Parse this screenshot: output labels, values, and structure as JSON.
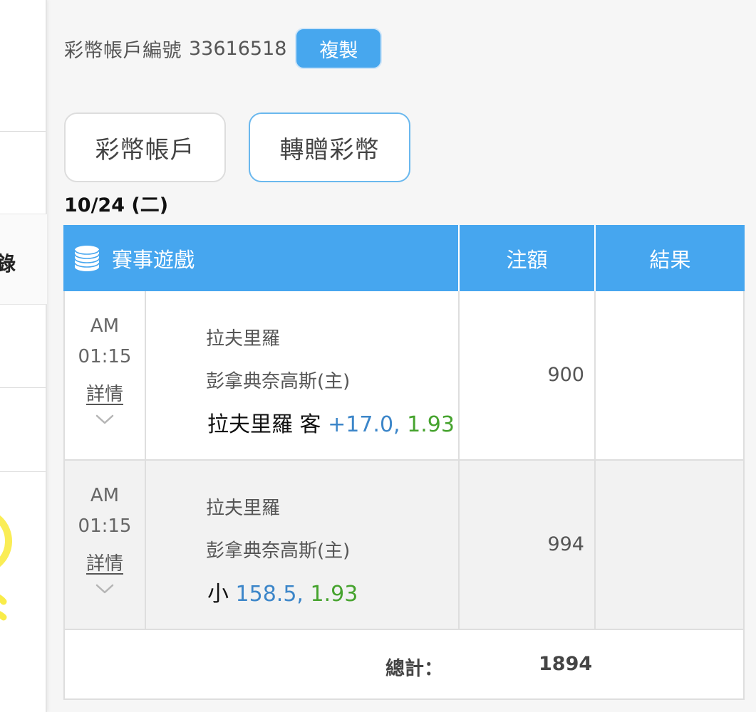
{
  "sidebar": {
    "active_item_label": "錄"
  },
  "account": {
    "label": "彩幣帳戶編號",
    "number": "33616518",
    "copy_label": "複製"
  },
  "tabs": [
    {
      "label": "彩幣帳戶"
    },
    {
      "label": "轉贈彩幣"
    }
  ],
  "date": "10/24 (二)",
  "table": {
    "headers": {
      "game": "賽事遊戲",
      "amount": "注額",
      "result": "結果"
    },
    "rows": [
      {
        "ampm": "AM",
        "time": "01:15",
        "detail_link": "詳情",
        "team1": "拉夫里羅",
        "team2": "彭拿典奈高斯(主)",
        "bet_pick": "拉夫里羅 客",
        "bet_line": "+17.0,",
        "bet_odds": "1.93",
        "amount": "900",
        "result": ""
      },
      {
        "ampm": "AM",
        "time": "01:15",
        "detail_link": "詳情",
        "team1": "拉夫里羅",
        "team2": "彭拿典奈高斯(主)",
        "bet_pick": "小",
        "bet_line": "158.5,",
        "bet_odds": "1.93",
        "amount": "994",
        "result": ""
      }
    ],
    "total_label": "總計：",
    "total_value": "1894"
  },
  "icons": {
    "header_icon": "database-icon",
    "expand_icon": "chevron-down-icon",
    "sidebar_icon": "lightbulb-icon"
  },
  "colors": {
    "header_blue": "#46a6ef",
    "copy_button": "#47a7ee",
    "line_blue": "#3c86c9",
    "odds_green": "#46a32e",
    "bulb_yellow": "#f8e71c"
  }
}
